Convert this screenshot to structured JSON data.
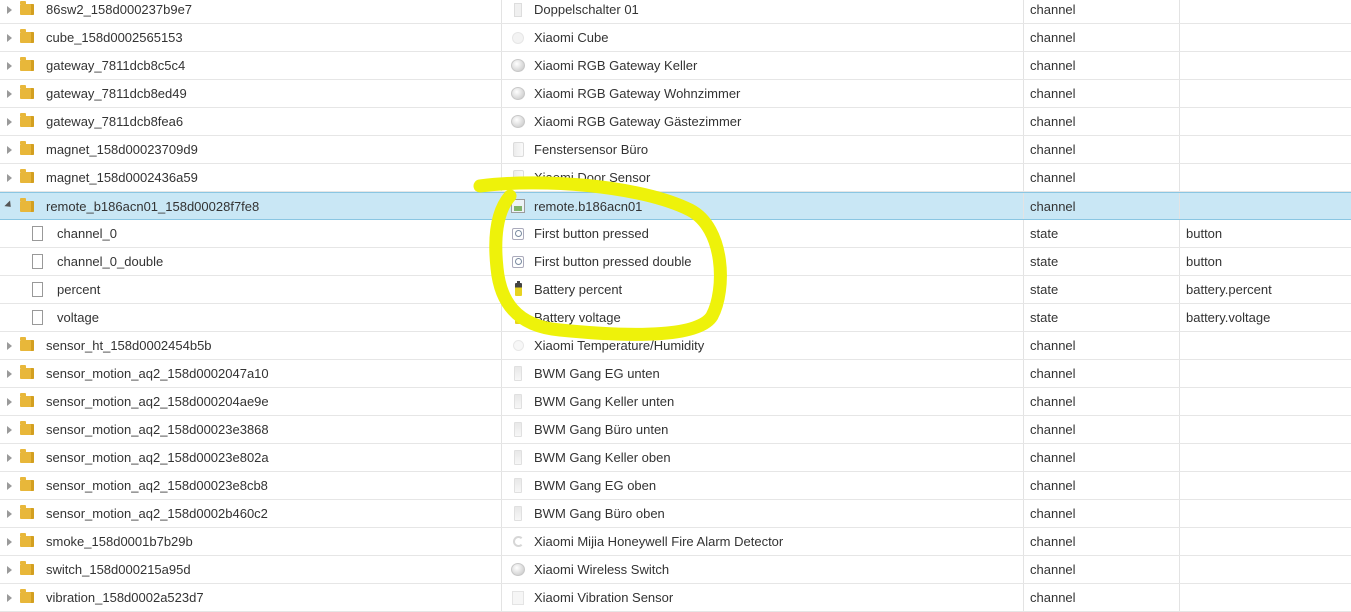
{
  "rows": [
    {
      "level": "object",
      "expanded": false,
      "id": "86sw2_158d000237b9e7",
      "icon": "switch-icon",
      "name": "Doppelschalter 01",
      "type": "channel",
      "role": ""
    },
    {
      "level": "object",
      "expanded": false,
      "id": "cube_158d0002565153",
      "icon": "cube-icon",
      "name": "Xiaomi Cube",
      "type": "channel",
      "role": ""
    },
    {
      "level": "object",
      "expanded": false,
      "id": "gateway_7811dcb8c5c4",
      "icon": "gateway-icon",
      "name": "Xiaomi RGB Gateway Keller",
      "type": "channel",
      "role": ""
    },
    {
      "level": "object",
      "expanded": false,
      "id": "gateway_7811dcb8ed49",
      "icon": "gateway-icon",
      "name": "Xiaomi RGB Gateway Wohnzimmer",
      "type": "channel",
      "role": ""
    },
    {
      "level": "object",
      "expanded": false,
      "id": "gateway_7811dcb8fea6",
      "icon": "gateway-icon",
      "name": "Xiaomi RGB Gateway Gästezimmer",
      "type": "channel",
      "role": ""
    },
    {
      "level": "object",
      "expanded": false,
      "id": "magnet_158d00023709d9",
      "icon": "magnet-icon",
      "name": "Fenstersensor Büro",
      "type": "channel",
      "role": ""
    },
    {
      "level": "object",
      "expanded": false,
      "id": "magnet_158d0002436a59",
      "icon": "magnet-icon",
      "name": "Xiaomi Door Sensor",
      "type": "channel",
      "role": ""
    },
    {
      "level": "object",
      "expanded": true,
      "selected": true,
      "id": "remote_b186acn01_158d00028f7fe8",
      "icon": "broken-image-icon",
      "name": "remote.b186acn01",
      "type": "channel",
      "role": ""
    },
    {
      "level": "state",
      "id": "channel_0",
      "icon": "button-icon",
      "name": "First button pressed",
      "type": "state",
      "role": "button"
    },
    {
      "level": "state",
      "id": "channel_0_double",
      "icon": "button-icon",
      "name": "First button pressed double",
      "type": "state",
      "role": "button"
    },
    {
      "level": "state",
      "id": "percent",
      "icon": "battery-icon",
      "name": "Battery percent",
      "type": "state",
      "role": "battery.percent"
    },
    {
      "level": "state",
      "id": "voltage",
      "icon": "battery-icon",
      "name": "Battery voltage",
      "type": "state",
      "role": "battery.voltage"
    },
    {
      "level": "object",
      "expanded": false,
      "id": "sensor_ht_158d0002454b5b",
      "icon": "temperature-icon",
      "name": "Xiaomi Temperature/Humidity",
      "type": "channel",
      "role": ""
    },
    {
      "level": "object",
      "expanded": false,
      "id": "sensor_motion_aq2_158d0002047a10",
      "icon": "motion-icon",
      "name": "BWM Gang EG unten",
      "type": "channel",
      "role": ""
    },
    {
      "level": "object",
      "expanded": false,
      "id": "sensor_motion_aq2_158d000204ae9e",
      "icon": "motion-icon",
      "name": "BWM Gang Keller unten",
      "type": "channel",
      "role": ""
    },
    {
      "level": "object",
      "expanded": false,
      "id": "sensor_motion_aq2_158d00023e3868",
      "icon": "motion-icon",
      "name": "BWM Gang Büro unten",
      "type": "channel",
      "role": ""
    },
    {
      "level": "object",
      "expanded": false,
      "id": "sensor_motion_aq2_158d00023e802a",
      "icon": "motion-icon",
      "name": "BWM Gang Keller oben",
      "type": "channel",
      "role": ""
    },
    {
      "level": "object",
      "expanded": false,
      "id": "sensor_motion_aq2_158d00023e8cb8",
      "icon": "motion-icon",
      "name": "BWM Gang EG oben",
      "type": "channel",
      "role": ""
    },
    {
      "level": "object",
      "expanded": false,
      "id": "sensor_motion_aq2_158d0002b460c2",
      "icon": "motion-icon",
      "name": "BWM Gang Büro oben",
      "type": "channel",
      "role": ""
    },
    {
      "level": "object",
      "expanded": false,
      "id": "smoke_158d0001b7b29b",
      "icon": "smoke-detector-icon",
      "name": "Xiaomi Mijia Honeywell Fire Alarm Detector",
      "type": "channel",
      "role": ""
    },
    {
      "level": "object",
      "expanded": false,
      "id": "switch_158d000215a95d",
      "icon": "wireless-switch-icon",
      "name": "Xiaomi Wireless Switch",
      "type": "channel",
      "role": ""
    },
    {
      "level": "object",
      "expanded": false,
      "id": "vibration_158d0002a523d7",
      "icon": "vibration-sensor-icon",
      "name": "Xiaomi Vibration Sensor",
      "type": "channel",
      "role": ""
    }
  ],
  "annotation": {
    "color": "#eef20a"
  },
  "colors": {
    "selected_row": "#c9e7f5",
    "folder": "#e8b73a"
  }
}
